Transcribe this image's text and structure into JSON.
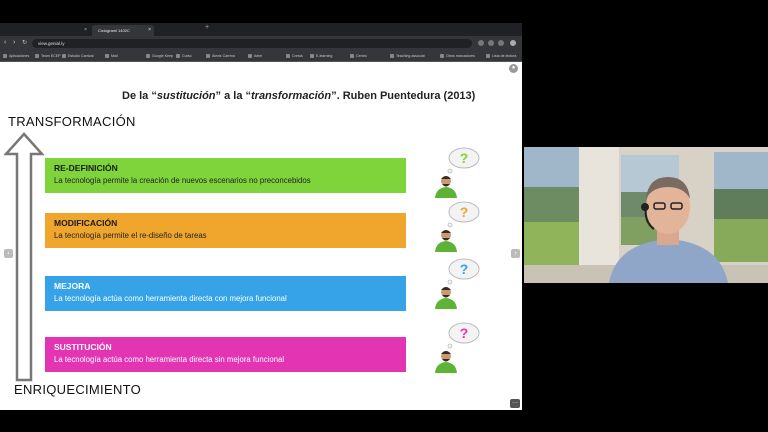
{
  "browser": {
    "tabs": [
      {
        "label": ""
      },
      {
        "label": "Ciclogrami 1402C"
      },
      {
        "label": ""
      }
    ],
    "url": "view.genial.ly",
    "bookmarks": [
      "Aplicaciones",
      "Team ECEP",
      "Estudio Carrizal",
      "Mail",
      "Google Keep",
      "Curso",
      "Alexis Carrera",
      "Aeim",
      "Cresta",
      "E-learning",
      "Centro",
      "Teaching associat",
      "Otros marcadores",
      "Lista de lectura"
    ]
  },
  "slide": {
    "title_prefix": "De la “",
    "title_word1": "sustitución",
    "title_mid": "” a la “",
    "title_word2": "transformación",
    "title_suffix": "”. Ruben Puentedura (2013)",
    "top_label": "TRANSFORMACIÓN",
    "bottom_label": "ENRIQUECIMIENTO",
    "levels": [
      {
        "name": "RE-DEFINICIÓN",
        "desc": "La tecnología permite la creación de nuevos escenarios no preconcebidos",
        "bubble": "?",
        "bubble_color": "#7ed43a"
      },
      {
        "name": "MODIFICACIÓN",
        "desc": "La tecnología permite el re-diseño de tareas",
        "bubble": "?",
        "bubble_color": "#f0a62d"
      },
      {
        "name": "MEJORA",
        "desc": "La tecnología actúa como herramienta directa con mejora funcional",
        "bubble": "?",
        "bubble_color": "#36a3e8"
      },
      {
        "name": "SUSTITUCIÓN",
        "desc": "La tecnología actúa como herramienta directa sin mejora funcional",
        "bubble": "?",
        "bubble_color": "#e335b3"
      }
    ],
    "nav_prev": "‹",
    "nav_next": "›",
    "more": "···"
  },
  "colors": {
    "redefinicion": "#7ed43a",
    "modificacion": "#f0a62d",
    "mejora": "#36a3e8",
    "sustitucion": "#e335b3"
  }
}
